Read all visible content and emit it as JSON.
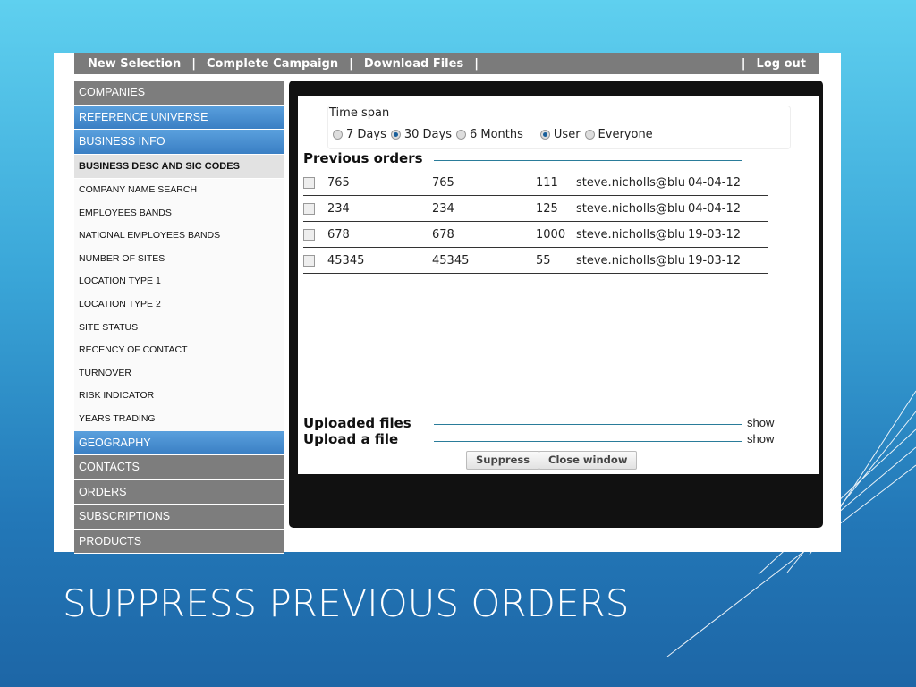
{
  "slide": {
    "title": "SUPPRESS PREVIOUS ORDERS"
  },
  "nav": {
    "items": [
      "New Selection",
      "Complete Campaign",
      "Download Files"
    ],
    "logout": "Log out"
  },
  "sidebar": {
    "top": [
      {
        "label": "COMPANIES",
        "style": "gray"
      },
      {
        "label": "REFERENCE UNIVERSE",
        "style": "blue"
      },
      {
        "label": "BUSINESS INFO",
        "style": "blue"
      },
      {
        "label": "BUSINESS DESC AND SIC CODES",
        "style": "active"
      }
    ],
    "sub": [
      "COMPANY NAME SEARCH",
      "EMPLOYEES BANDS",
      "NATIONAL EMPLOYEES BANDS",
      "NUMBER OF SITES",
      "LOCATION TYPE 1",
      "LOCATION TYPE 2",
      "SITE STATUS",
      "RECENCY OF CONTACT",
      "TURNOVER",
      "RISK INDICATOR",
      "YEARS TRADING"
    ],
    "bottom": [
      {
        "label": "GEOGRAPHY",
        "style": "blue"
      },
      {
        "label": "CONTACTS",
        "style": "gray"
      },
      {
        "label": "ORDERS",
        "style": "gray"
      },
      {
        "label": "SUBSCRIPTIONS",
        "style": "gray"
      },
      {
        "label": "PRODUCTS",
        "style": "gray"
      }
    ]
  },
  "dialog": {
    "timespan": {
      "label": "Time span",
      "options": [
        {
          "label": "7 Days",
          "checked": false
        },
        {
          "label": "30 Days",
          "checked": true
        },
        {
          "label": "6 Months",
          "checked": false
        }
      ],
      "scope": [
        {
          "label": "User",
          "checked": true
        },
        {
          "label": "Everyone",
          "checked": false
        }
      ]
    },
    "previous_orders": {
      "heading": "Previous orders",
      "rows": [
        [
          "765",
          "765",
          "111",
          "steve.nicholls@blu",
          "04-04-12"
        ],
        [
          "234",
          "234",
          "125",
          "steve.nicholls@blu",
          "04-04-12"
        ],
        [
          "678",
          "678",
          "1000",
          "steve.nicholls@blu",
          "19-03-12"
        ],
        [
          "45345",
          "45345",
          "55",
          "steve.nicholls@blu",
          "19-03-12"
        ]
      ]
    },
    "uploaded_files": {
      "heading": "Uploaded files",
      "link": "show"
    },
    "upload_file": {
      "heading": "Upload a file",
      "link": "show"
    },
    "buttons": {
      "suppress": "Suppress",
      "close": "Close window"
    }
  },
  "colors": {
    "nav": "#7b7b7b",
    "sidebar_blue": "#3a7fc4",
    "sidebar_gray": "#7d7d7d",
    "dialog_frame": "#111111"
  }
}
